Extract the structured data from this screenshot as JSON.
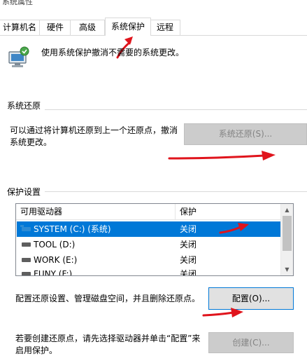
{
  "window": {
    "title": "系统属性"
  },
  "tabs": [
    {
      "label": "计算机名",
      "active": false
    },
    {
      "label": "硬件",
      "active": false
    },
    {
      "label": "高级",
      "active": false
    },
    {
      "label": "系统保护",
      "active": true
    },
    {
      "label": "远程",
      "active": false
    }
  ],
  "intro": {
    "text": "使用系统保护撤消不需要的系统更改。",
    "icon": "computer-shield-icon"
  },
  "restore": {
    "group_title": "系统还原",
    "desc_line1": "可以通过将计算机还原到上一个还原点，撤消",
    "desc_line2": "系统更改。",
    "button_label": "系统还原(S)...",
    "button_enabled": false
  },
  "protection": {
    "group_title": "保护设置",
    "columns": [
      "可用驱动器",
      "保护"
    ],
    "drives": [
      {
        "name": "SYSTEM (C:) (系统)",
        "status": "关闭",
        "selected": true,
        "icon": "system-drive-icon"
      },
      {
        "name": "TOOL (D:)",
        "status": "关闭",
        "selected": false,
        "icon": "drive-icon"
      },
      {
        "name": "WORK (E:)",
        "status": "关闭",
        "selected": false,
        "icon": "drive-icon"
      },
      {
        "name": "FUNY (F:)",
        "status": "关闭",
        "selected": false,
        "icon": "drive-icon"
      }
    ],
    "configure_desc": "配置还原设置、管理磁盘空间，并且删除还原点。",
    "configure_label": "配置(O)...",
    "create_desc_line1": "若要创建还原点，请先选择驱动器并单击“配置”来",
    "create_desc_line2": "启用保护。",
    "create_label": "创建(C)..."
  },
  "colors": {
    "accent": "#0078d7",
    "annotation": "#e0141c"
  }
}
